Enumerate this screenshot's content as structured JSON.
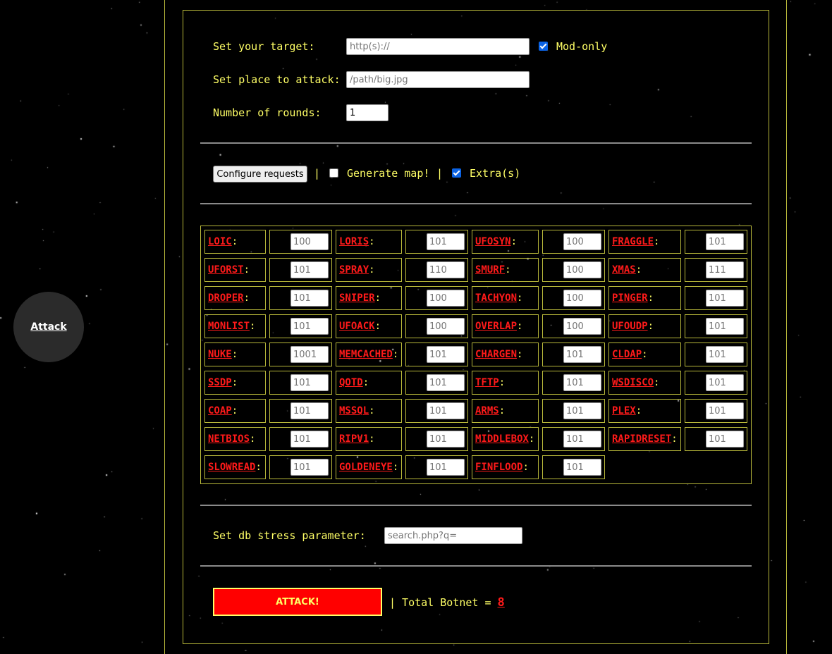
{
  "side_menu": {
    "attack_link": "Attack"
  },
  "target": {
    "label": "Set your target:",
    "placeholder": "http(s)://",
    "mod_only_label": "Mod-only",
    "mod_only_checked": true
  },
  "place": {
    "label": "Set place to attack:",
    "placeholder": "/path/big.jpg"
  },
  "rounds": {
    "label": "Number of rounds:",
    "value": "1"
  },
  "options": {
    "configure_button": "Configure requests",
    "separator": "|",
    "generate_map_label": "Generate map!",
    "generate_map_checked": false,
    "extras_label": "Extra(s)",
    "extras_checked": true
  },
  "attacks": [
    [
      "LOIC",
      "100"
    ],
    [
      "LORIS",
      "101"
    ],
    [
      "UFOSYN",
      "100"
    ],
    [
      "FRAGGLE",
      "101"
    ],
    [
      "UFORST",
      "101"
    ],
    [
      "SPRAY",
      "110"
    ],
    [
      "SMURF",
      "100"
    ],
    [
      "XMAS",
      "111"
    ],
    [
      "DROPER",
      "101"
    ],
    [
      "SNIPER",
      "100"
    ],
    [
      "TACHYON",
      "100"
    ],
    [
      "PINGER",
      "101"
    ],
    [
      "MONLIST",
      "101"
    ],
    [
      "UFOACK",
      "100"
    ],
    [
      "OVERLAP",
      "100"
    ],
    [
      "UFOUDP",
      "101"
    ],
    [
      "NUKE",
      "1001"
    ],
    [
      "MEMCACHED",
      "101"
    ],
    [
      "CHARGEN",
      "101"
    ],
    [
      "CLDAP",
      "101"
    ],
    [
      "SSDP",
      "101"
    ],
    [
      "QOTD",
      "101"
    ],
    [
      "TFTP",
      "101"
    ],
    [
      "WSDISCO",
      "101"
    ],
    [
      "COAP",
      "101"
    ],
    [
      "MSSQL",
      "101"
    ],
    [
      "ARMS",
      "101"
    ],
    [
      "PLEX",
      "101"
    ],
    [
      "NETBIOS",
      "101"
    ],
    [
      "RIPV1",
      "101"
    ],
    [
      "MIDDLEBOX",
      "101"
    ],
    [
      "RAPIDRESET",
      "101"
    ],
    [
      "SLOWREAD",
      "101"
    ],
    [
      "GOLDENEYE",
      "101"
    ],
    [
      "FINFLOOD",
      "101"
    ]
  ],
  "dbstress": {
    "label": "Set db stress parameter:",
    "placeholder": "search.php?q="
  },
  "footer": {
    "attack_button": "ATTACK!",
    "botnet_prefix": "| Total Botnet =",
    "botnet_count": "8"
  },
  "colors": {
    "accent": "#ffff66",
    "alert": "#ff1a1a",
    "button": "#ff0000",
    "border": "#b8b83a"
  }
}
